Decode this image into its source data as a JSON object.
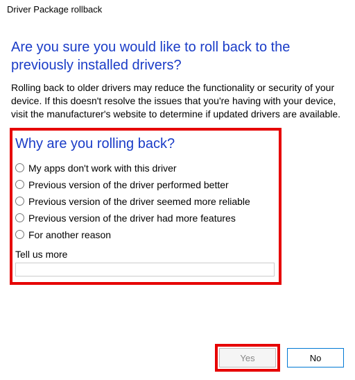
{
  "window": {
    "title": "Driver Package rollback"
  },
  "heading": "Are you sure you would like to roll back to the previously installed drivers?",
  "body": "Rolling back to older drivers may reduce the functionality or security of your device. If this doesn't resolve the issues that you're having with your device, visit the manufacturer's website to determine if updated drivers are available.",
  "section_heading": "Why are you rolling back?",
  "reasons": [
    "My apps don't work with this driver",
    "Previous version of the driver performed better",
    "Previous version of the driver seemed more reliable",
    "Previous version of the driver had more features",
    "For another reason"
  ],
  "tell_us_label": "Tell us more",
  "tell_us_value": "",
  "buttons": {
    "yes": "Yes",
    "no": "No"
  }
}
